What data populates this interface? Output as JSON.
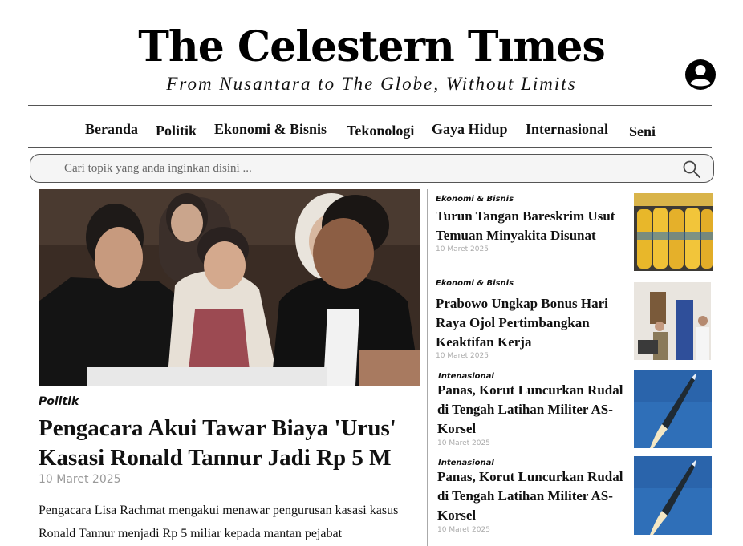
{
  "masthead": {
    "title": "The Celestern Tımes",
    "tagline": "From Nusantara to The Globe, Without Limits",
    "account_icon": "user-circle-icon"
  },
  "nav": {
    "items": [
      {
        "label": "Beranda"
      },
      {
        "label": "Politik"
      },
      {
        "label": "Ekonomi & Bisnis"
      },
      {
        "label": "Tekonologi"
      },
      {
        "label": "Gaya Hidup"
      },
      {
        "label": "Internasional"
      },
      {
        "label": "Seni"
      }
    ]
  },
  "search": {
    "placeholder": "Cari topik yang anda inginkan disini ...",
    "value": "",
    "icon": "search-icon"
  },
  "hero": {
    "category": "Politik",
    "title": "Pengacara Akui Tawar Biaya 'Urus' Kasasi Ronald Tannur Jadi Rp 5 M",
    "date": "10 Maret 2025",
    "excerpt": "Pengacara Lisa Rachmat mengakui menawar pengurusan kasasi kasus Ronald Tannur menjadi Rp 5 miliar kepada mantan pejabat"
  },
  "side_articles": [
    {
      "category": "Ekonomi & Bisnis",
      "title": "Turun Tangan Bareskrim Usut Temuan Minyakita Disunat",
      "date": "10 Maret 2025"
    },
    {
      "category": "Ekonomi & Bisnis",
      "title": "Prabowo Ungkap Bonus Hari Raya Ojol Pertimbangkan Keaktifan Kerja",
      "date": "10 Maret 2025"
    },
    {
      "category": "Intenasional",
      "title": "Panas, Korut Luncurkan Rudal di Tengah Latihan Militer AS-Korsel",
      "date": "10 Maret 2025"
    },
    {
      "category": "Intenasional",
      "title": "Panas, Korut Luncurkan Rudal di Tengah Latihan Militer AS-Korsel",
      "date": "10 Maret 2025"
    }
  ],
  "colors": {
    "text": "#111111",
    "date": "#9a9a9a",
    "search_bg": "#f5f5f5",
    "rule": "#555555"
  }
}
